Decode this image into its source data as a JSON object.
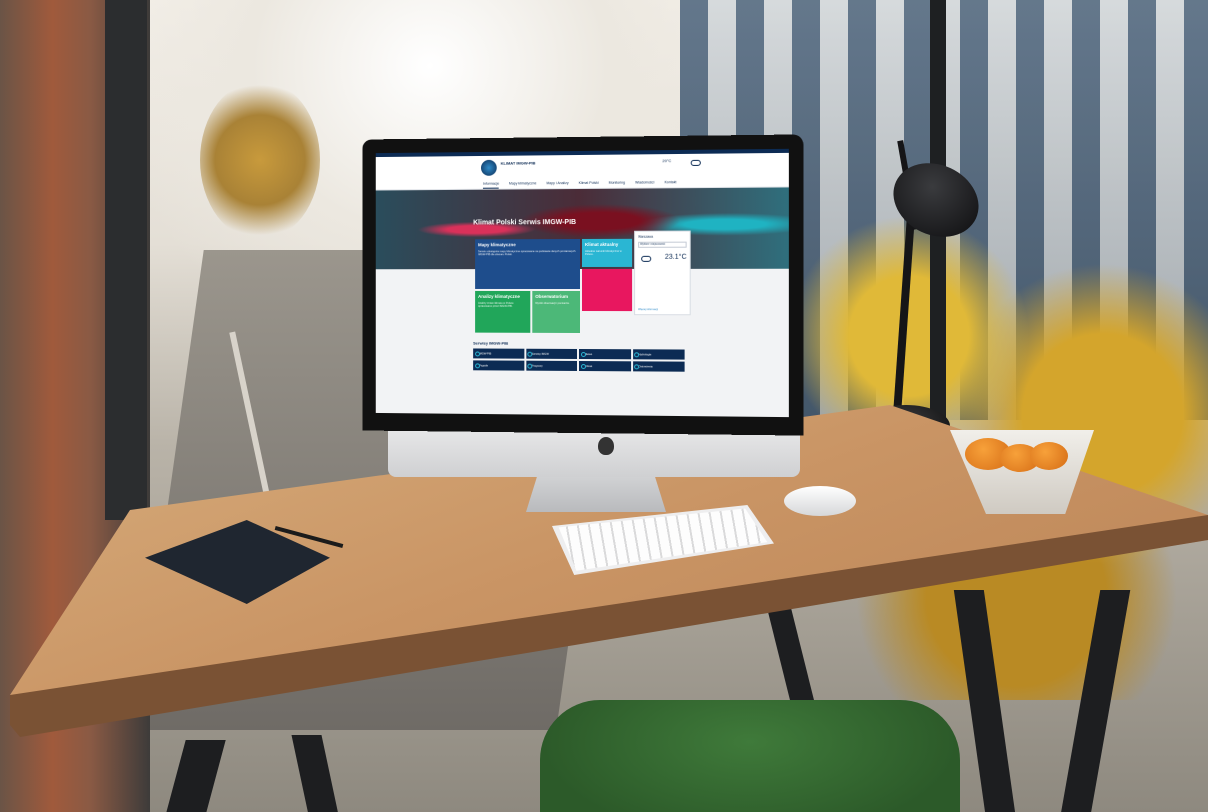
{
  "site": {
    "logo_text": "KLIMAT IMGW-PIB",
    "header_weather": "20°C",
    "nav": [
      "Informacje",
      "Mapy klimatyczne",
      "Mapy i Analizy",
      "Klimat Polski",
      "Monitoring",
      "Wiadomości",
      "Kontakt"
    ],
    "hero_title": "Klimat Polski Serwis IMGW-PIB",
    "tiles": {
      "maps": {
        "title": "Mapy klimatyczne",
        "text": "Serwis udostępnia mapy klimatyczne opracowane na podstawie danych pomiarowych IMGW-PIB dla obszaru Polski."
      },
      "warnings": {
        "title": "Klimat aktualny",
        "text": "Aktualne warunki klimatyczne w Polsce."
      },
      "climate": {
        "title": "Analizy klimatyczne",
        "text": "Analizy zmian klimatu w Polsce opracowane przez IMGW-PIB."
      },
      "observations": {
        "title": "Obserwatorium",
        "text": "Wyniki obserwacji i pomiarów."
      }
    },
    "weather_card": {
      "title": "Warszawa",
      "select": "Wybierz miejscowość",
      "temp": "23.1°C",
      "link": "Więcej informacji"
    },
    "services_title": "Serwisy IMGW-PIB",
    "services": [
      "IMGW-PIB",
      "Serwisy IMGW",
      "Meteo",
      "Hydrologia",
      "Pogoda",
      "Prognozy",
      "Klimat",
      "Ostrzeżenia"
    ]
  },
  "colors": {
    "navy": "#0c2b54",
    "blue": "#1e4d8c",
    "cyan": "#2ab6d3",
    "green": "#21a65a",
    "pink": "#e8175f"
  }
}
